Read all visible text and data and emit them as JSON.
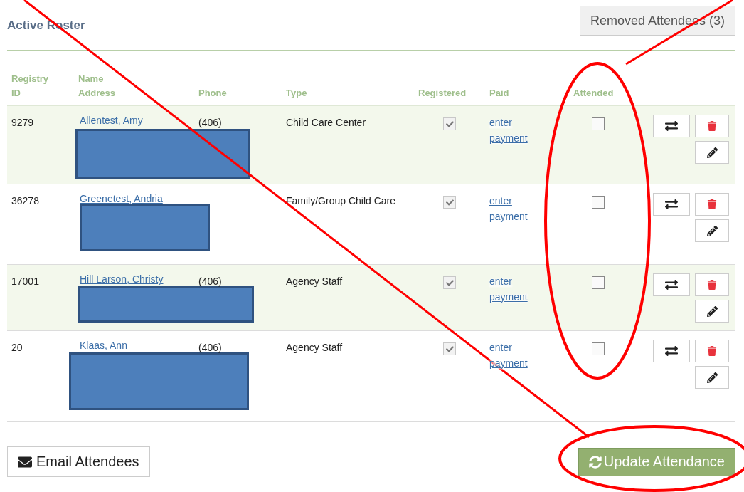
{
  "title": "Active Roster",
  "removed_button": "Removed Attendees (3)",
  "columns": [
    {
      "lines": [
        "Registry",
        "ID"
      ]
    },
    {
      "lines": [
        "Name",
        "Address"
      ]
    },
    {
      "lines": [
        "Phone"
      ]
    },
    {
      "lines": [
        "Type"
      ]
    },
    {
      "lines": [
        "Registered"
      ]
    },
    {
      "lines": [
        "Paid"
      ]
    },
    {
      "lines": [
        "Attended"
      ]
    }
  ],
  "rows": [
    {
      "id": "9279",
      "name": "Allentest, Amy",
      "phone": "(406)",
      "type": "Child Care Center",
      "registered": true,
      "paid_link": "enter payment",
      "attended": false,
      "address_redacted": true
    },
    {
      "id": "36278",
      "name": "Greenetest, Andria",
      "type": "Family/Group Child Care",
      "registered": true,
      "paid_link": "enter payment",
      "attended": false,
      "address_redacted": true
    },
    {
      "id": "17001",
      "name": "Hill Larson, Christy",
      "phone": "(406)",
      "type": "Agency Staff",
      "registered": true,
      "paid_link": "enter payment",
      "attended": false,
      "address_redacted": true
    },
    {
      "id": "20",
      "name": "Klaas, Ann",
      "phone": "(406)",
      "type": "Agency Staff",
      "registered": true,
      "paid_link": "enter payment",
      "attended": false,
      "address_redacted": true
    }
  ],
  "email_button": "Email Attendees",
  "update_button": "Update Attendance"
}
